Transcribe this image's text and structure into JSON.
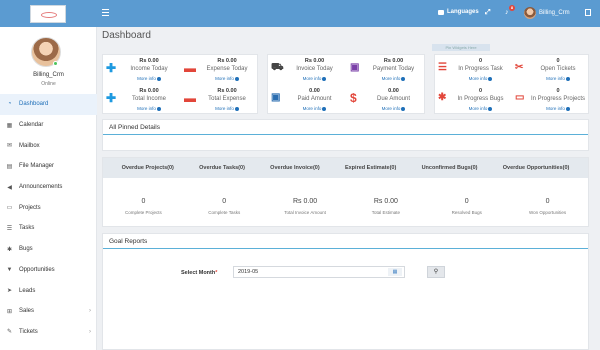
{
  "topbar": {
    "languages_label": "Languages",
    "notification_count": "8",
    "user_name": "Billing_Crm"
  },
  "sidebar": {
    "user_name": "Billing_Crm",
    "status": "Online",
    "items": [
      {
        "label": "Dashboard",
        "icon": "dashboard-icon",
        "active": true
      },
      {
        "label": "Calendar",
        "icon": "calendar-icon"
      },
      {
        "label": "Mailbox",
        "icon": "envelope-icon"
      },
      {
        "label": "File Manager",
        "icon": "file-manager-icon"
      },
      {
        "label": "Announcements",
        "icon": "bullhorn-icon"
      },
      {
        "label": "Projects",
        "icon": "folder-icon"
      },
      {
        "label": "Tasks",
        "icon": "tasks-icon"
      },
      {
        "label": "Bugs",
        "icon": "bug-icon"
      },
      {
        "label": "Opportunities",
        "icon": "filter-icon"
      },
      {
        "label": "Leads",
        "icon": "rocket-icon"
      },
      {
        "label": "Sales",
        "icon": "cart-icon",
        "has_submenu": true
      },
      {
        "label": "Tickets",
        "icon": "ticket-icon",
        "has_submenu": true
      }
    ]
  },
  "page": {
    "title": "Dashboard",
    "ghost_chip": "Pin Widgets Here"
  },
  "stats": {
    "income_today": {
      "value": "Rs 0.00",
      "label": "Income Today",
      "more": "More info"
    },
    "expense_today": {
      "value": "Rs 0.00",
      "label": "Expense Today",
      "more": "More info"
    },
    "total_income": {
      "value": "Rs 0.00",
      "label": "Total Income",
      "more": "More info"
    },
    "total_expense": {
      "value": "Rs 0.00",
      "label": "Total Expense",
      "more": "More info"
    },
    "invoice_today": {
      "value": "Rs 0.00",
      "label": "Invoice Today",
      "more": "More info"
    },
    "payment_today": {
      "value": "Rs 0.00",
      "label": "Payment Today",
      "more": "More info"
    },
    "paid_amount": {
      "value": "0.00",
      "label": "Paid Amount",
      "more": "More info"
    },
    "due_amount": {
      "value": "0.00",
      "label": "Due Amount",
      "more": "More info"
    },
    "in_progress_task": {
      "value": "0",
      "label": "In Progress Task",
      "more": "More info"
    },
    "open_tickets": {
      "value": "0",
      "label": "Open Tickets",
      "more": "More info"
    },
    "in_progress_bugs": {
      "value": "0",
      "label": "In Progress Bugs",
      "more": "More info"
    },
    "in_progress_projects": {
      "value": "0",
      "label": "In Progress Projects",
      "more": "More info"
    }
  },
  "pinned": {
    "title": "All Pinned Details"
  },
  "overdue_tabs": [
    "Overdue Projects(0)",
    "Overdue Tasks(0)",
    "Overdue Invoice(0)",
    "Expired Estimate(0)",
    "Unconfirmed Bugs(0)",
    "Overdue Opportunities(0)"
  ],
  "summary": [
    {
      "value": "0",
      "label": "Complete Projects"
    },
    {
      "value": "0",
      "label": "Complete Tasks"
    },
    {
      "value": "Rs 0.00",
      "label": "Total Invoice Amount"
    },
    {
      "value": "Rs 0.00",
      "label": "Total Estimate"
    },
    {
      "value": "0",
      "label": "Resolved Bugs"
    },
    {
      "value": "0",
      "label": "Won Opportunities"
    }
  ],
  "goal_reports": {
    "title": "Goal Reports",
    "month_label": "Select Month",
    "required_mark": "*",
    "month_value": "2019-05"
  },
  "colors": {
    "topbar": "#5b9bd1",
    "accent_blue": "#1f6fb8",
    "plus_blue": "#1e9ae0",
    "minus_red": "#e2463a"
  }
}
